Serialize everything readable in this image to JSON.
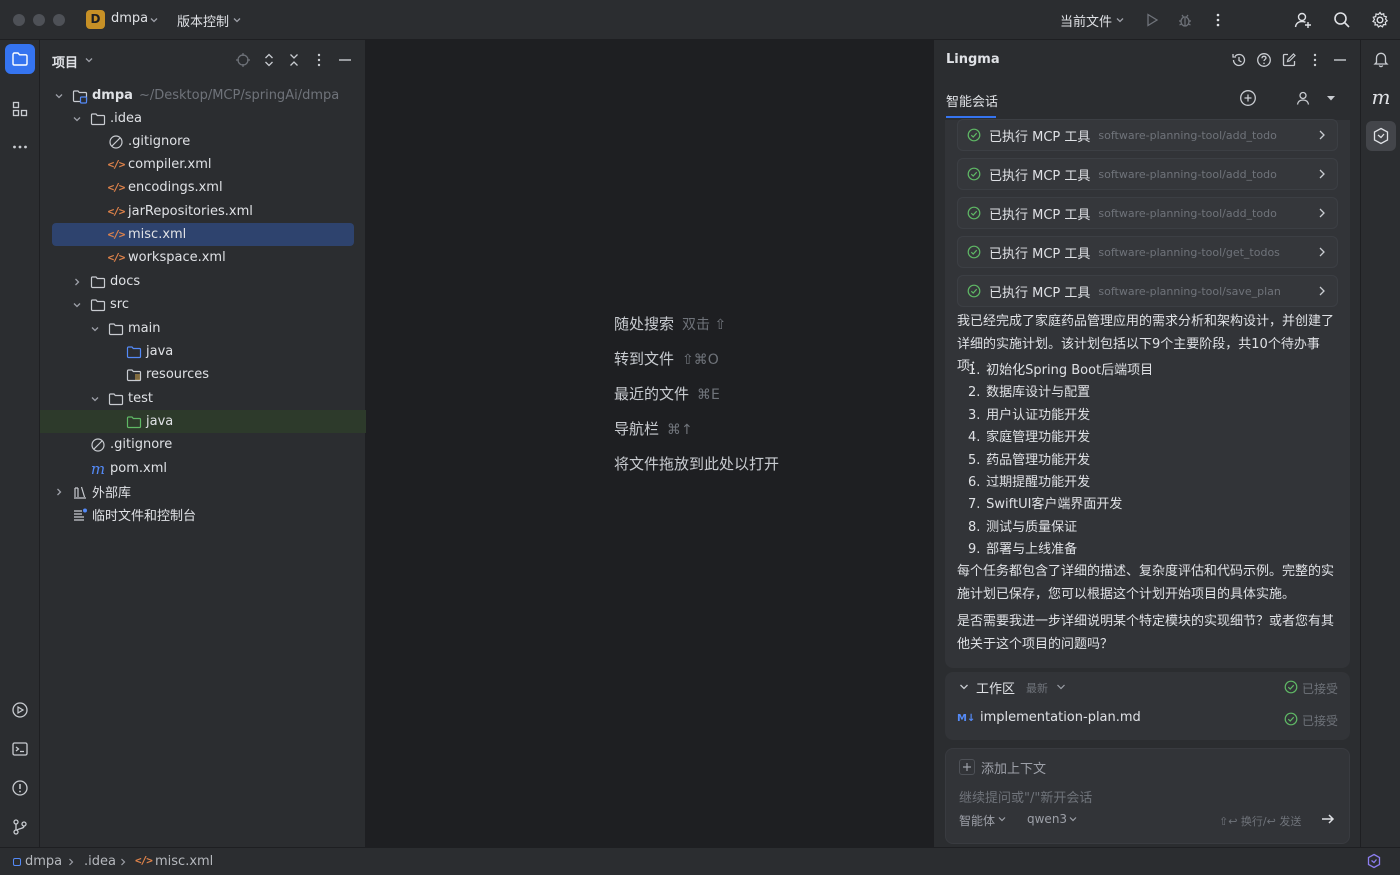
{
  "titlebar": {
    "project_badge": "D",
    "project_name": "dmpa",
    "vcs_label": "版本控制",
    "run_config": "当前文件"
  },
  "project_panel": {
    "title": "项目",
    "tree": [
      {
        "label": "dmpa",
        "path": "~/Desktop/MCP/springAi/dmpa",
        "icon": "module-folder-icon",
        "expanded": true
      },
      {
        "label": ".idea",
        "icon": "folder-icon",
        "expanded": true
      },
      {
        "label": ".gitignore",
        "icon": "ignored-file-icon"
      },
      {
        "label": "compiler.xml",
        "icon": "xml-file-icon"
      },
      {
        "label": "encodings.xml",
        "icon": "xml-file-icon"
      },
      {
        "label": "jarRepositories.xml",
        "icon": "xml-file-icon"
      },
      {
        "label": "misc.xml",
        "icon": "xml-file-icon",
        "selected": true
      },
      {
        "label": "workspace.xml",
        "icon": "xml-file-icon"
      },
      {
        "label": "docs",
        "icon": "folder-icon",
        "expanded": false
      },
      {
        "label": "src",
        "icon": "folder-icon",
        "expanded": true
      },
      {
        "label": "main",
        "icon": "folder-icon",
        "expanded": true
      },
      {
        "label": "java",
        "icon": "source-folder-icon"
      },
      {
        "label": "resources",
        "icon": "resources-folder-icon"
      },
      {
        "label": "test",
        "icon": "folder-icon",
        "expanded": true
      },
      {
        "label": "java",
        "icon": "test-folder-icon"
      },
      {
        "label": ".gitignore",
        "icon": "ignored-file-icon"
      },
      {
        "label": "pom.xml",
        "icon": "maven-file-icon"
      },
      {
        "label": "外部库",
        "icon": "library-icon",
        "expanded": false
      },
      {
        "label": "临时文件和控制台",
        "icon": "scratches-icon"
      }
    ]
  },
  "editor": {
    "hints": [
      {
        "label": "随处搜索",
        "key": "双击 ⇧"
      },
      {
        "label": "转到文件",
        "key": "⇧⌘O"
      },
      {
        "label": "最近的文件",
        "key": "⌘E"
      },
      {
        "label": "导航栏",
        "key": "⌘↑"
      },
      {
        "label": "将文件拖放到此处以打开",
        "key": ""
      }
    ]
  },
  "lingma": {
    "title": "Lingma",
    "tab": "智能会话",
    "tool_calls": [
      {
        "label": "已执行 MCP 工具",
        "tool": "software-planning-tool/add_todo"
      },
      {
        "label": "已执行 MCP 工具",
        "tool": "software-planning-tool/add_todo"
      },
      {
        "label": "已执行 MCP 工具",
        "tool": "software-planning-tool/add_todo"
      },
      {
        "label": "已执行 MCP 工具",
        "tool": "software-planning-tool/get_todos"
      },
      {
        "label": "已执行 MCP 工具",
        "tool": "software-planning-tool/save_plan"
      }
    ],
    "message_intro": "我已经完成了家庭药品管理应用的需求分析和架构设计，并创建了详细的实施计划。该计划包括以下9个主要阶段，共10个待办事项：",
    "phases": [
      "初始化Spring Boot后端项目",
      "数据库设计与配置",
      "用户认证功能开发",
      "家庭管理功能开发",
      "药品管理功能开发",
      "过期提醒功能开发",
      "SwiftUI客户端界面开发",
      "测试与质量保证",
      "部署与上线准备"
    ],
    "message_summary": "每个任务都包含了详细的描述、复杂度评估和代码示例。完整的实施计划已保存，您可以根据这个计划开始项目的具体实施。",
    "message_question": "是否需要我进一步详细说明某个特定模块的实现细节？或者您有其他关于这个项目的问题吗？",
    "workspace": {
      "title": "工作区",
      "filter": "最新",
      "status": "已接受",
      "file_badge": "M↓",
      "file": "implementation-plan.md",
      "file_status": "已接受"
    },
    "input": {
      "add_context": "添加上下文",
      "placeholder": "继续提问或\"/\"新开会话",
      "mode": "智能体",
      "model": "qwen3",
      "send_hint": "⇧↩ 换行/↩ 发送"
    }
  },
  "statusbar": {
    "breadcrumb": [
      "dmpa",
      ".idea",
      "misc.xml"
    ]
  },
  "colors": {
    "accent": "#3574f0",
    "success": "#5fb865",
    "xml": "#e0834a"
  }
}
